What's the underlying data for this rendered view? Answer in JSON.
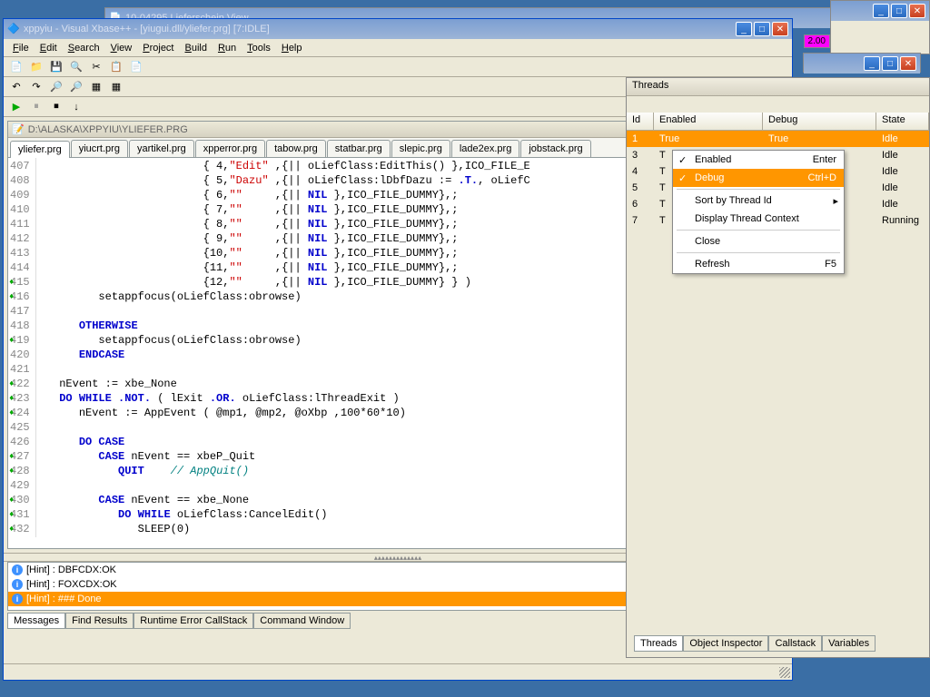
{
  "bg_windows": {
    "lieferschein_title": "10-04295 Lieferschein View"
  },
  "main": {
    "title": "xppyiu - Visual Xbase++ -  [yiugui.dll/yliefer.prg] [7:IDLE]",
    "menus": [
      "File",
      "Edit",
      "Search",
      "View",
      "Project",
      "Build",
      "Run",
      "Tools",
      "Help"
    ],
    "doc_title": "D:\\ALASKA\\XPPYIU\\YLIEFER.PRG",
    "tabs": [
      "yliefer.prg",
      "yiucrt.prg",
      "yartikel.prg",
      "xpperror.prg",
      "tabow.prg",
      "statbar.prg",
      "slepic.prg",
      "lade2ex.prg",
      "jobstack.prg"
    ],
    "code_lines": [
      {
        "n": 407,
        "m": false,
        "html": "                         { <span class='num'>4</span>,<span class='str'>\"Edit\"</span> ,{|| oLiefClass:EditThis() },ICO_FILE_E"
      },
      {
        "n": 408,
        "m": false,
        "html": "                         { <span class='num'>5</span>,<span class='str'>\"Dazu\"</span> ,{|| oLiefClass:lDbfDazu := <span class='kw'>.T.</span>, oLiefC"
      },
      {
        "n": 409,
        "m": false,
        "html": "                         { <span class='num'>6</span>,<span class='str'>\"\"</span>     ,{|| <span class='kw'>NIL</span> },ICO_FILE_DUMMY},;"
      },
      {
        "n": 410,
        "m": false,
        "html": "                         { <span class='num'>7</span>,<span class='str'>\"\"</span>     ,{|| <span class='kw'>NIL</span> },ICO_FILE_DUMMY},;"
      },
      {
        "n": 411,
        "m": false,
        "html": "                         { <span class='num'>8</span>,<span class='str'>\"\"</span>     ,{|| <span class='kw'>NIL</span> },ICO_FILE_DUMMY},;"
      },
      {
        "n": 412,
        "m": false,
        "html": "                         { <span class='num'>9</span>,<span class='str'>\"\"</span>     ,{|| <span class='kw'>NIL</span> },ICO_FILE_DUMMY},;"
      },
      {
        "n": 413,
        "m": false,
        "html": "                         {<span class='num'>10</span>,<span class='str'>\"\"</span>     ,{|| <span class='kw'>NIL</span> },ICO_FILE_DUMMY},;"
      },
      {
        "n": 414,
        "m": false,
        "html": "                         {<span class='num'>11</span>,<span class='str'>\"\"</span>     ,{|| <span class='kw'>NIL</span> },ICO_FILE_DUMMY},;"
      },
      {
        "n": 415,
        "m": true,
        "html": "                         {<span class='num'>12</span>,<span class='str'>\"\"</span>     ,{|| <span class='kw'>NIL</span> },ICO_FILE_DUMMY} } )"
      },
      {
        "n": 416,
        "m": true,
        "html": "         setappfocus(oLiefClass:obrowse)"
      },
      {
        "n": 417,
        "m": false,
        "html": ""
      },
      {
        "n": 418,
        "m": false,
        "html": "      <span class='kw'>OTHERWISE</span>"
      },
      {
        "n": 419,
        "m": true,
        "html": "         setappfocus(oLiefClass:obrowse)"
      },
      {
        "n": 420,
        "m": false,
        "html": "      <span class='kw'>ENDCASE</span>"
      },
      {
        "n": 421,
        "m": false,
        "html": ""
      },
      {
        "n": 422,
        "m": true,
        "html": "   nEvent := xbe_None"
      },
      {
        "n": 423,
        "m": true,
        "html": "   <span class='kw'>DO WHILE</span> <span class='kw'>.NOT.</span> ( lExit <span class='kw'>.OR.</span> oLiefClass:lThreadExit )"
      },
      {
        "n": 424,
        "m": true,
        "html": "      nEvent := AppEvent ( @mp1, @mp2, @oXbp ,<span class='num'>100</span>*<span class='num'>60</span>*<span class='num'>10</span>)"
      },
      {
        "n": 425,
        "m": false,
        "html": ""
      },
      {
        "n": 426,
        "m": false,
        "html": "      <span class='kw'>DO CASE</span>"
      },
      {
        "n": 427,
        "m": true,
        "html": "         <span class='kw'>CASE</span> nEvent == xbeP_Quit"
      },
      {
        "n": 428,
        "m": true,
        "html": "            <span class='kw'>QUIT</span>    <span class='com'>// AppQuit()</span>"
      },
      {
        "n": 429,
        "m": false,
        "html": ""
      },
      {
        "n": 430,
        "m": true,
        "html": "         <span class='kw'>CASE</span> nEvent == xbe_None"
      },
      {
        "n": 431,
        "m": true,
        "html": "            <span class='kw'>DO WHILE</span> oLiefClass:CancelEdit()"
      },
      {
        "n": 432,
        "m": true,
        "html": "               SLEEP(<span class='num'>0</span>)"
      }
    ],
    "hints": [
      {
        "text": "[Hint] : DBFCDX:OK",
        "sel": false
      },
      {
        "text": "[Hint] : FOXCDX:OK",
        "sel": false
      },
      {
        "text": "[Hint] : ### Done",
        "sel": true
      }
    ],
    "bottom_tabs": [
      "Messages",
      "Find Results",
      "Runtime Error CallStack",
      "Command Window"
    ]
  },
  "threads": {
    "title": "Threads",
    "columns": [
      "Id",
      "Enabled",
      "Debug",
      "State"
    ],
    "rows": [
      {
        "id": "1",
        "enabled": "True",
        "debug": "True",
        "state": "Idle",
        "sel": true
      },
      {
        "id": "3",
        "enabled": "T",
        "debug": "",
        "state": "Idle",
        "sel": false
      },
      {
        "id": "4",
        "enabled": "T",
        "debug": "",
        "state": "Idle",
        "sel": false
      },
      {
        "id": "5",
        "enabled": "T",
        "debug": "",
        "state": "Idle",
        "sel": false
      },
      {
        "id": "6",
        "enabled": "T",
        "debug": "",
        "state": "Idle",
        "sel": false
      },
      {
        "id": "7",
        "enabled": "T",
        "debug": "",
        "state": "Running",
        "sel": false
      }
    ],
    "bottom_tabs": [
      "Threads",
      "Object Inspector",
      "Callstack",
      "Variables"
    ]
  },
  "context_menu": {
    "items": [
      {
        "label": "Enabled",
        "check": true,
        "shortcut": "Enter"
      },
      {
        "label": "Debug",
        "check": true,
        "shortcut": "Ctrl+D",
        "sel": true
      },
      {
        "sep": true
      },
      {
        "label": "Sort by Thread Id",
        "sub": true
      },
      {
        "label": "Display Thread Context"
      },
      {
        "sep": true
      },
      {
        "label": "Close"
      },
      {
        "sep": true
      },
      {
        "label": "Refresh",
        "shortcut": "F5"
      }
    ]
  },
  "indicator": {
    "text": "2.00"
  }
}
